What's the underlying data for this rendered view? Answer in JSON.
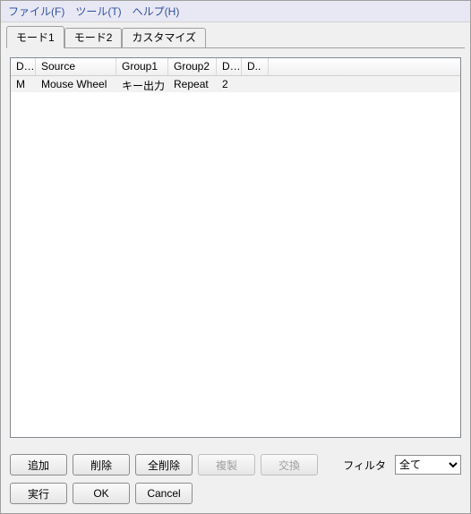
{
  "menu": {
    "file": "ファイル(F)",
    "tool": "ツール(T)",
    "help": "ヘルプ(H)"
  },
  "tabs": {
    "t0": "モード1",
    "t1": "モード2",
    "t2": "カスタマイズ"
  },
  "list": {
    "headers": {
      "c0": "D..",
      "c1": "Source",
      "c2": "Group1",
      "c3": "Group2",
      "c4": "D..",
      "c5": "D.."
    },
    "rows": [
      {
        "c0": "M",
        "c1": "Mouse Wheel",
        "c2": "キー出力",
        "c3": "Repeat",
        "c4": "2",
        "c5": ""
      }
    ]
  },
  "buttons": {
    "add": "追加",
    "delete": "削除",
    "delete_all": "全削除",
    "duplicate": "複製",
    "swap": "交換",
    "execute": "実行",
    "ok": "OK",
    "cancel": "Cancel"
  },
  "filter": {
    "label": "フィルタ",
    "selected": "全て"
  }
}
